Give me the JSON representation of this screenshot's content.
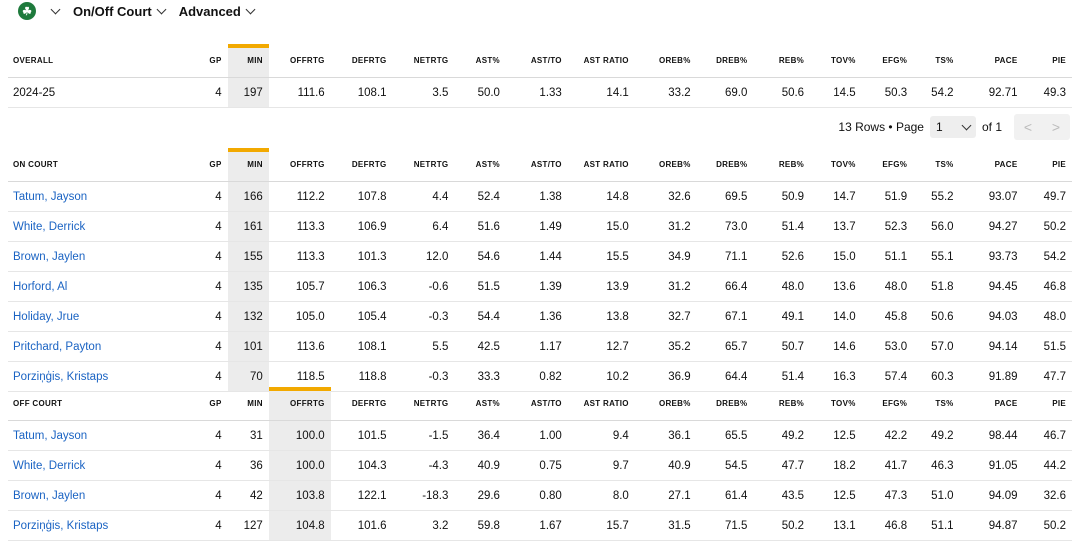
{
  "header": {
    "team_logo_icon": "celtics-logo-icon",
    "dropdown1": "On/Off Court",
    "dropdown2": "Advanced"
  },
  "columns": [
    "GP",
    "MIN",
    "OFFRTG",
    "DEFRTG",
    "NETRTG",
    "AST%",
    "AST/TO",
    "AST RATIO",
    "OREB%",
    "DREB%",
    "REB%",
    "TOV%",
    "EFG%",
    "TS%",
    "PACE",
    "PIE"
  ],
  "overall": {
    "label": "OVERALL",
    "rows": [
      {
        "name": "2024-25",
        "v": [
          "4",
          "197",
          "111.6",
          "108.1",
          "3.5",
          "50.0",
          "1.33",
          "14.1",
          "33.2",
          "69.0",
          "50.6",
          "14.5",
          "50.3",
          "54.2",
          "92.71",
          "49.3"
        ]
      }
    ]
  },
  "pager": {
    "rows_text": "13 Rows • Page",
    "page": "1",
    "of": "of 1",
    "prev": "<",
    "next": ">"
  },
  "on_court": {
    "label": "ON COURT",
    "rows": [
      {
        "name": "Tatum, Jayson",
        "v": [
          "4",
          "166",
          "112.2",
          "107.8",
          "4.4",
          "52.4",
          "1.38",
          "14.8",
          "32.6",
          "69.5",
          "50.9",
          "14.7",
          "51.9",
          "55.2",
          "93.07",
          "49.7"
        ]
      },
      {
        "name": "White, Derrick",
        "v": [
          "4",
          "161",
          "113.3",
          "106.9",
          "6.4",
          "51.6",
          "1.49",
          "15.0",
          "31.2",
          "73.0",
          "51.4",
          "13.7",
          "52.3",
          "56.0",
          "94.27",
          "50.2"
        ]
      },
      {
        "name": "Brown, Jaylen",
        "v": [
          "4",
          "155",
          "113.3",
          "101.3",
          "12.0",
          "54.6",
          "1.44",
          "15.5",
          "34.9",
          "71.1",
          "52.6",
          "15.0",
          "51.1",
          "55.1",
          "93.73",
          "54.2"
        ]
      },
      {
        "name": "Horford, Al",
        "v": [
          "4",
          "135",
          "105.7",
          "106.3",
          "-0.6",
          "51.5",
          "1.39",
          "13.9",
          "31.2",
          "66.4",
          "48.0",
          "13.6",
          "48.0",
          "51.8",
          "94.45",
          "46.8"
        ]
      },
      {
        "name": "Holiday, Jrue",
        "v": [
          "4",
          "132",
          "105.0",
          "105.4",
          "-0.3",
          "54.4",
          "1.36",
          "13.8",
          "32.7",
          "67.1",
          "49.1",
          "14.0",
          "45.8",
          "50.6",
          "94.03",
          "48.0"
        ]
      },
      {
        "name": "Pritchard, Payton",
        "v": [
          "4",
          "101",
          "113.6",
          "108.1",
          "5.5",
          "42.5",
          "1.17",
          "12.7",
          "35.2",
          "65.7",
          "50.7",
          "14.6",
          "53.0",
          "57.0",
          "94.14",
          "51.5"
        ]
      },
      {
        "name": "Porziņģis, Kristaps",
        "v": [
          "4",
          "70",
          "118.5",
          "118.8",
          "-0.3",
          "33.3",
          "0.82",
          "10.2",
          "36.9",
          "64.4",
          "51.4",
          "16.3",
          "57.4",
          "60.3",
          "91.89",
          "47.7"
        ]
      }
    ]
  },
  "off_court": {
    "label": "OFF COURT",
    "rows": [
      {
        "name": "Tatum, Jayson",
        "v": [
          "4",
          "31",
          "100.0",
          "101.5",
          "-1.5",
          "36.4",
          "1.00",
          "9.4",
          "36.1",
          "65.5",
          "49.2",
          "12.5",
          "42.2",
          "49.2",
          "98.44",
          "46.7"
        ]
      },
      {
        "name": "White, Derrick",
        "v": [
          "4",
          "36",
          "100.0",
          "104.3",
          "-4.3",
          "40.9",
          "0.75",
          "9.7",
          "40.9",
          "54.5",
          "47.7",
          "18.2",
          "41.7",
          "46.3",
          "91.05",
          "44.2"
        ]
      },
      {
        "name": "Brown, Jaylen",
        "v": [
          "4",
          "42",
          "103.8",
          "122.1",
          "-18.3",
          "29.6",
          "0.80",
          "8.0",
          "27.1",
          "61.4",
          "43.5",
          "12.5",
          "47.3",
          "51.0",
          "94.09",
          "32.6"
        ]
      },
      {
        "name": "Porziņģis, Kristaps",
        "v": [
          "4",
          "127",
          "104.8",
          "101.6",
          "3.2",
          "59.8",
          "1.67",
          "15.7",
          "31.5",
          "71.5",
          "50.2",
          "13.1",
          "46.8",
          "51.1",
          "94.87",
          "50.2"
        ]
      }
    ]
  },
  "colors": {
    "accent": "#f2a900",
    "link": "#1a63c3",
    "sorted_bg": "#ececec"
  }
}
